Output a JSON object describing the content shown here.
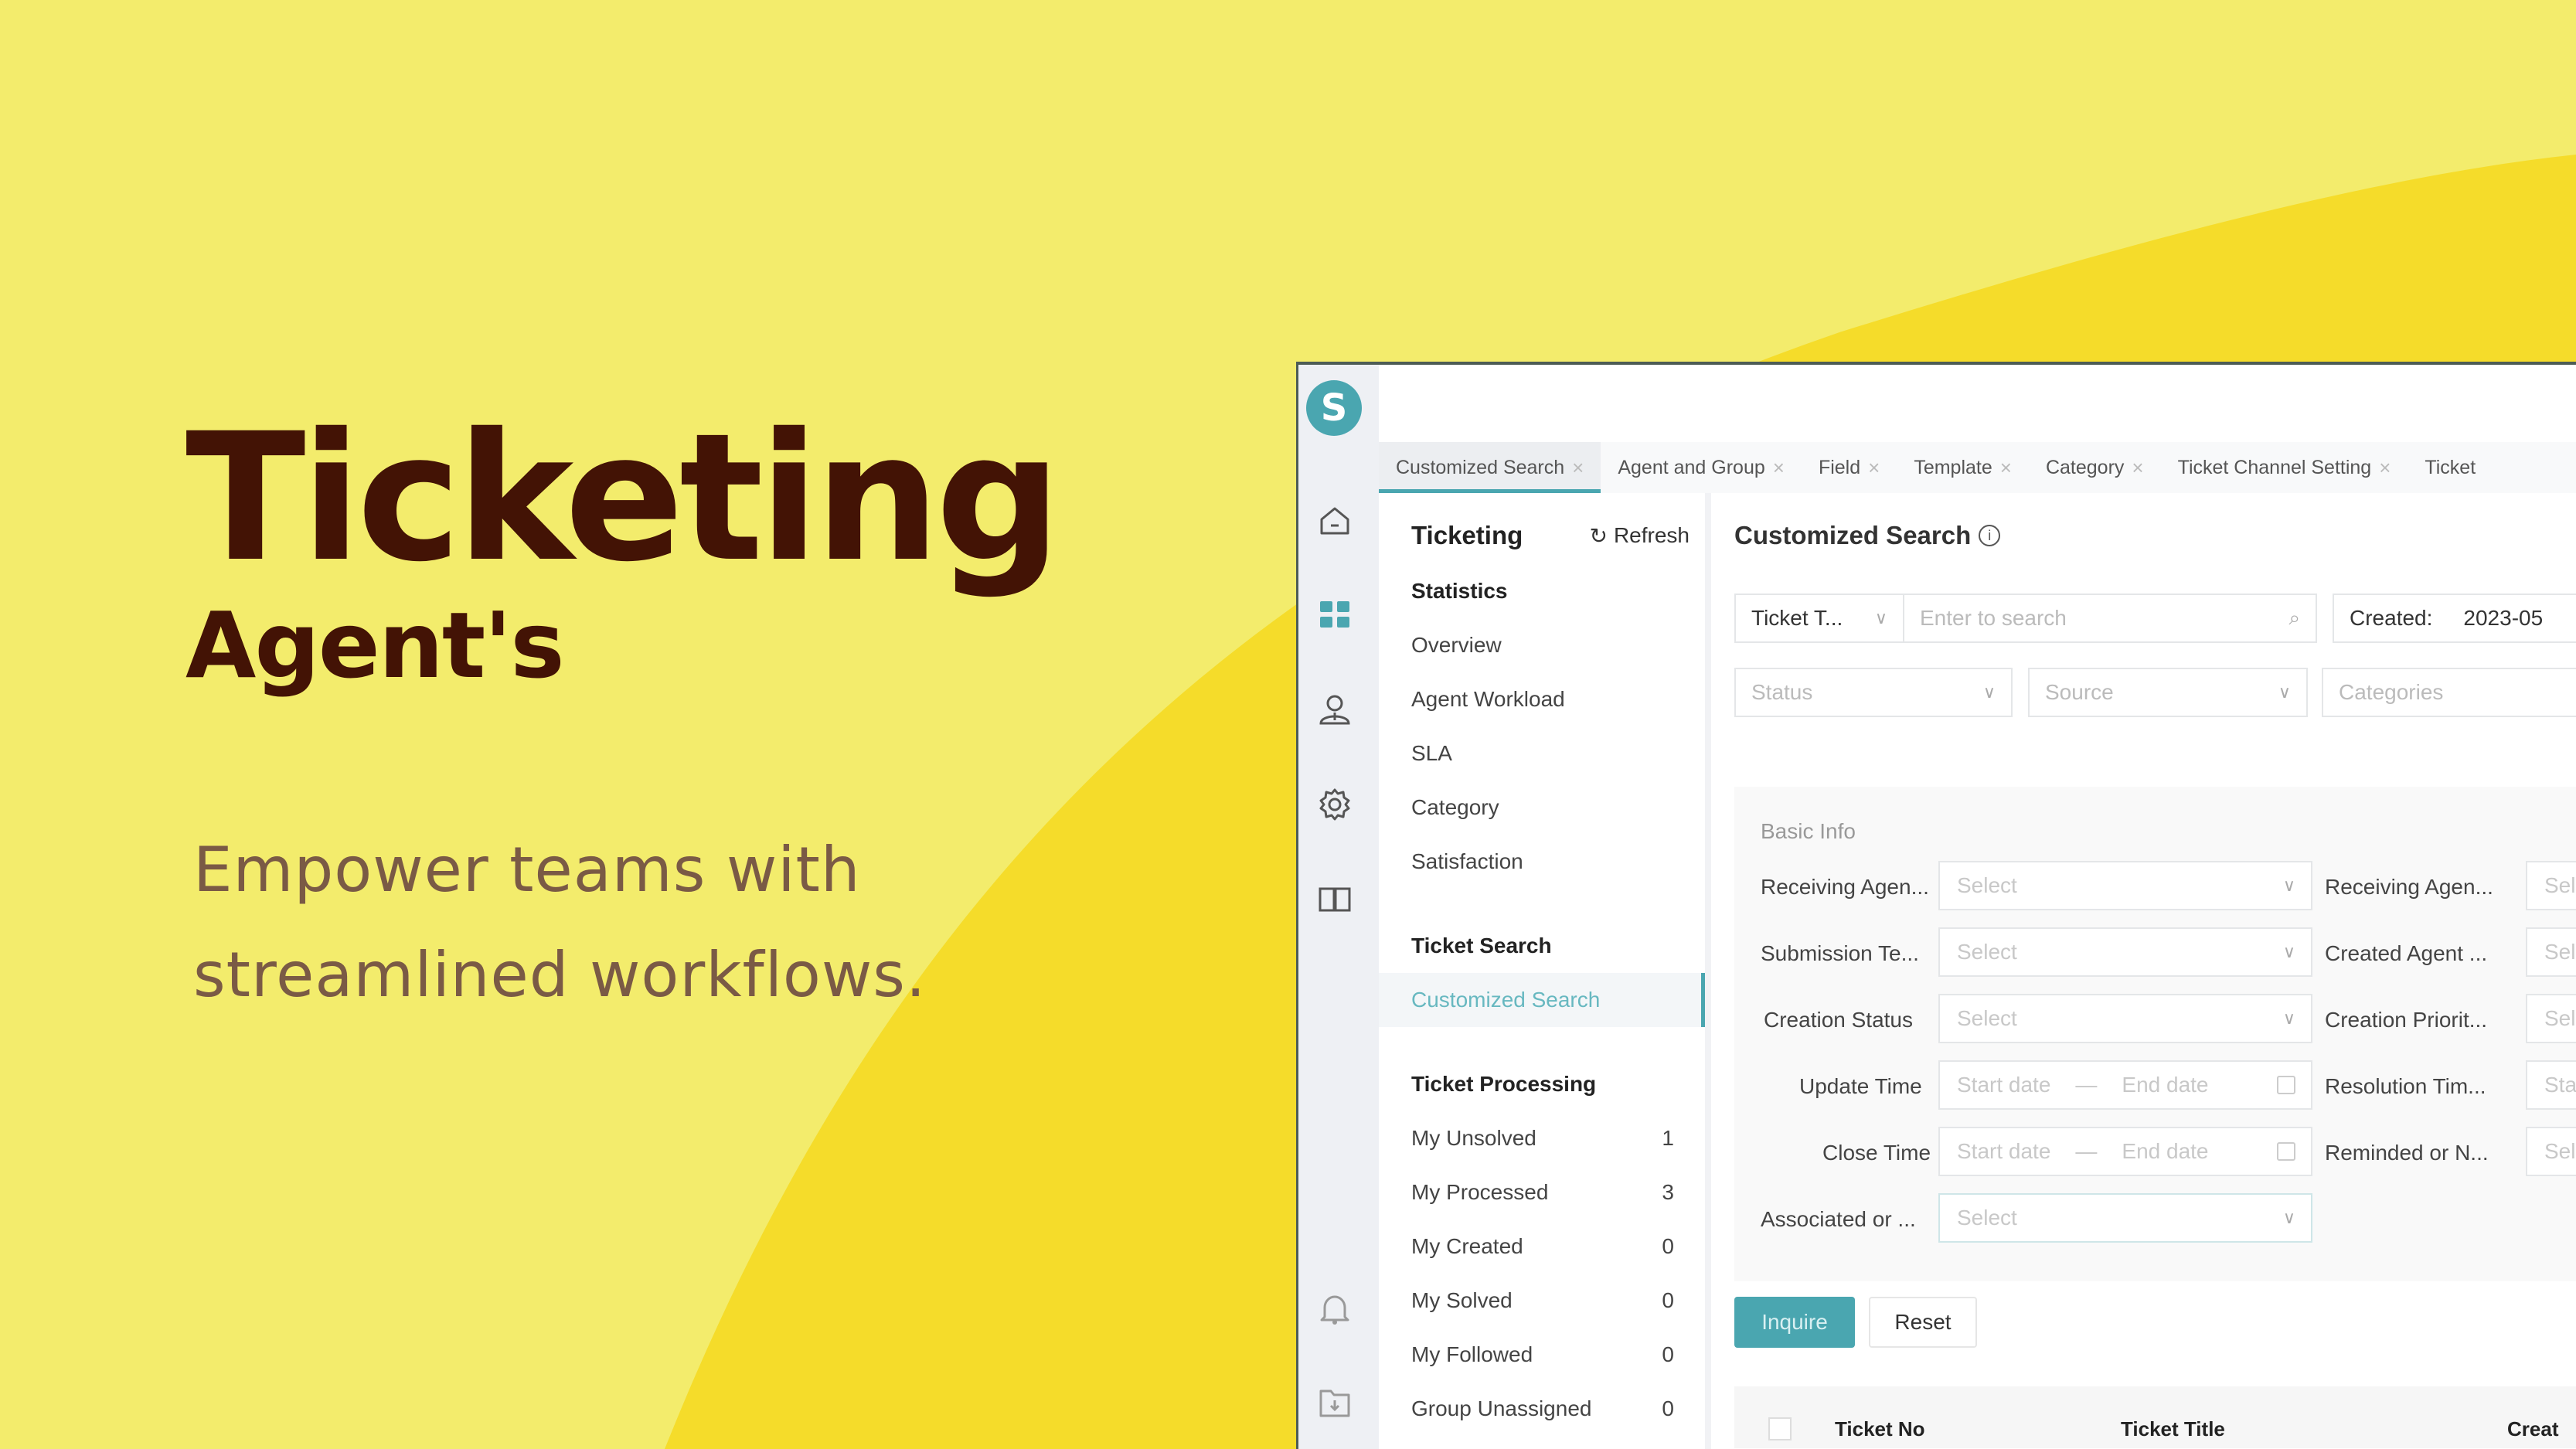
{
  "hero": {
    "title": "Ticketing",
    "subtitle": "Agent's",
    "tagline_line1": "Empower teams with",
    "tagline_line2": "streamlined workflows."
  },
  "colors": {
    "background_light": "#f3ec6c",
    "background_wave": "#f5dc2a",
    "title": "#431305",
    "tagline": "#7a5a45",
    "accent": "#4aa6b0"
  },
  "app": {
    "logo_letter": "S",
    "rail_icons": [
      "home-icon",
      "dashboard-icon",
      "agent-icon",
      "gear-icon",
      "book-icon",
      "bell-icon",
      "folder-download-icon"
    ],
    "tabs": [
      {
        "label": "Customized Search",
        "active": true
      },
      {
        "label": "Agent and Group",
        "active": false
      },
      {
        "label": "Field",
        "active": false
      },
      {
        "label": "Template",
        "active": false
      },
      {
        "label": "Category",
        "active": false
      },
      {
        "label": "Ticket Channel Setting",
        "active": false
      },
      {
        "label": "Ticket",
        "active": false
      }
    ],
    "nav": {
      "title": "Ticketing",
      "refresh_label": "Refresh",
      "sections": [
        {
          "title": "Statistics",
          "items": [
            {
              "label": "Overview"
            },
            {
              "label": "Agent Workload"
            },
            {
              "label": "SLA"
            },
            {
              "label": "Category"
            },
            {
              "label": "Satisfaction"
            }
          ]
        },
        {
          "title": "Ticket Search",
          "items": [
            {
              "label": "Customized Search",
              "active": true
            }
          ]
        },
        {
          "title": "Ticket Processing",
          "items": [
            {
              "label": "My Unsolved",
              "count": "1"
            },
            {
              "label": "My Processed",
              "count": "3"
            },
            {
              "label": "My Created",
              "count": "0"
            },
            {
              "label": "My Solved",
              "count": "0"
            },
            {
              "label": "My Followed",
              "count": "0"
            },
            {
              "label": "Group Unassigned",
              "count": "0"
            }
          ]
        }
      ]
    },
    "main": {
      "title": "Customized Search",
      "filters": {
        "ticket_type_value": "Ticket T...",
        "search_placeholder": "Enter to search",
        "created_label": "Created:",
        "created_value": "2023-05",
        "status_placeholder": "Status",
        "source_placeholder": "Source",
        "categories_placeholder": "Categories"
      },
      "basic_info": {
        "section_label": "Basic Info",
        "left_fields": [
          {
            "label": "Receiving Agen...",
            "type": "select",
            "placeholder": "Select"
          },
          {
            "label": "Submission Te...",
            "type": "select",
            "placeholder": "Select"
          },
          {
            "label": "Creation Status",
            "type": "select",
            "placeholder": "Select"
          },
          {
            "label": "Update Time",
            "type": "date",
            "start": "Start date",
            "end": "End date"
          },
          {
            "label": "Close Time",
            "type": "date",
            "start": "Start date",
            "end": "End date"
          },
          {
            "label": "Associated or ...",
            "type": "select",
            "placeholder": "Select"
          }
        ],
        "right_fields": [
          {
            "label": "Receiving Agen...",
            "placeholder": "Sele"
          },
          {
            "label": "Created Agent ...",
            "placeholder": "Sele"
          },
          {
            "label": "Creation Priorit...",
            "placeholder": "Sele"
          },
          {
            "label": "Resolution Tim...",
            "placeholder": "Star"
          },
          {
            "label": "Reminded or N...",
            "placeholder": "Sele"
          }
        ]
      },
      "buttons": {
        "inquire": "Inquire",
        "reset": "Reset"
      },
      "table": {
        "headers": [
          "Ticket No",
          "Ticket Title",
          "Creat"
        ]
      }
    }
  }
}
